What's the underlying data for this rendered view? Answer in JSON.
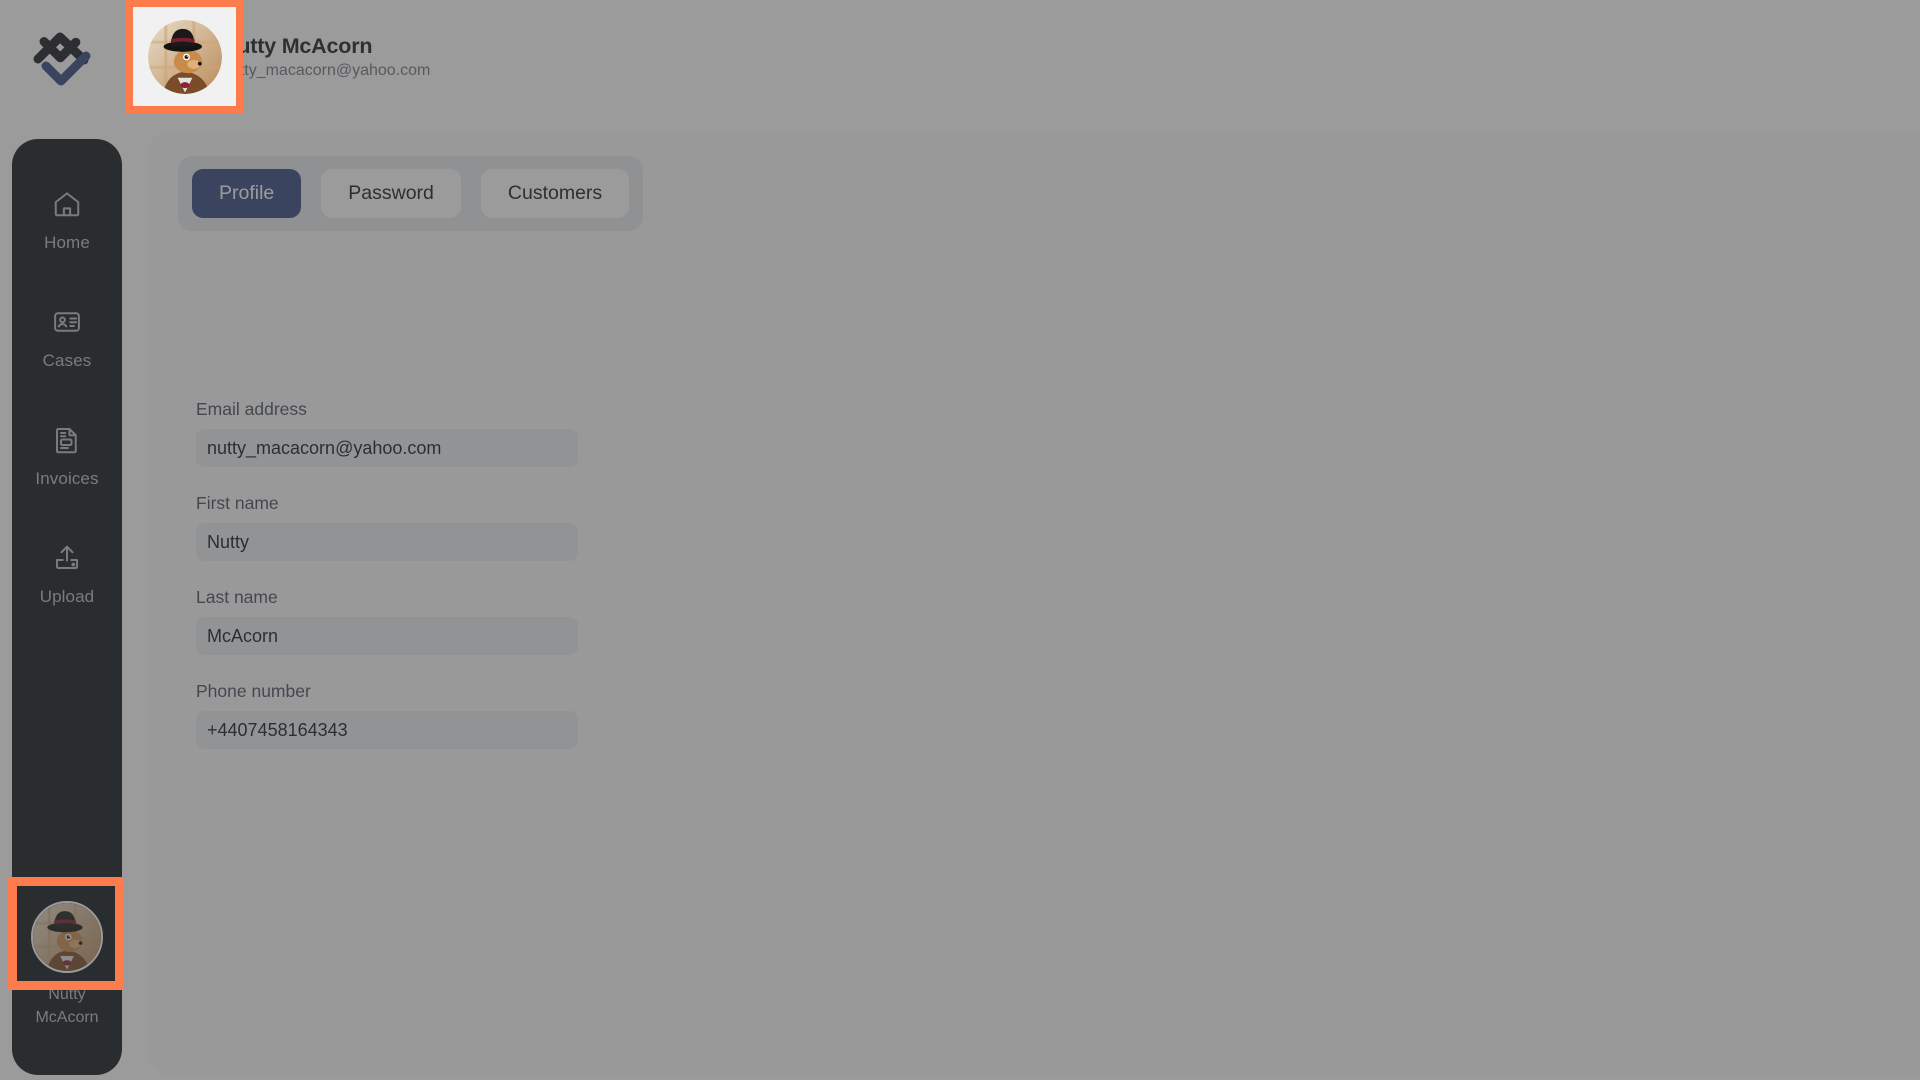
{
  "app": {
    "logo_name": "chevron-diamond-logo",
    "logo_dark_color": "#14181f",
    "logo_accent_color": "#33477f",
    "overlay_dim": true
  },
  "topbar": {
    "user_name": "Nutty McAcorn",
    "user_email": "nutty_macacorn@yahoo.com",
    "avatar_alt": "user-avatar"
  },
  "sidebar": {
    "items": [
      {
        "label": "Home",
        "icon": "home-icon"
      },
      {
        "label": "Cases",
        "icon": "id-card-icon"
      },
      {
        "label": "Invoices",
        "icon": "invoice-document-icon"
      },
      {
        "label": "Upload",
        "icon": "upload-icon"
      }
    ],
    "user": {
      "name_line1": "Nutty",
      "name_line2": "McAcorn",
      "avatar_alt": "sidebar-user-avatar"
    }
  },
  "tabs": [
    {
      "label": "Profile",
      "active": true
    },
    {
      "label": "Password",
      "active": false
    },
    {
      "label": "Customers",
      "active": false
    }
  ],
  "form": {
    "fields": [
      {
        "label": "Email address",
        "value": "nutty_macacorn@yahoo.com",
        "placeholder": "Email address",
        "name": "email-field"
      },
      {
        "label": "First name",
        "value": "Nutty",
        "placeholder": "First name",
        "name": "first-name-field"
      },
      {
        "label": "Last name",
        "value": "McAcorn",
        "placeholder": "Last name",
        "name": "last-name-field"
      },
      {
        "label": "Phone number",
        "value": "+4407458164343",
        "placeholder": "Phone number",
        "name": "phone-number-field"
      }
    ]
  },
  "highlights": {
    "accent_color": "#fd7c4d",
    "boxes": [
      {
        "target": "topbar-avatar"
      },
      {
        "target": "sidebar-user-avatar"
      }
    ]
  },
  "theme": {
    "sidebar_bg": "#10161c",
    "card_bg": "#fbfbfc",
    "tab_active_bg": "#33477f",
    "tabs_track_bg": "#e7e9ee",
    "input_bg": "#eceef2",
    "label_color": "#464f5c"
  }
}
